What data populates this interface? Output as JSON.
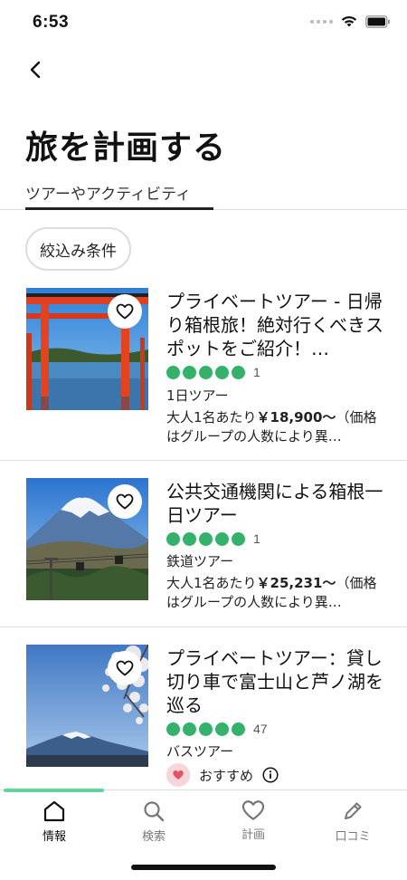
{
  "status_bar": {
    "time": "6:53"
  },
  "header": {
    "title": "旅を計画する",
    "tab": "ツアーやアクティビティ"
  },
  "filter": {
    "label": "絞込み条件"
  },
  "cards": [
    {
      "title": "プライベートツアー - 日帰り箱根旅！絶対行くべきスポットをご紹介！…",
      "rating_count": "1",
      "category": "1日ツアー",
      "price_prefix": "大人1名あたり",
      "price": "￥18,900～",
      "price_suffix": "（価格はグループの人数により異…"
    },
    {
      "title": "公共交通機関による箱根一日ツアー",
      "rating_count": "1",
      "category": "鉄道ツアー",
      "price_prefix": "大人1名あたり",
      "price": "￥25,231～",
      "price_suffix": "（価格はグループの人数により異…"
    },
    {
      "title": "プライベートツアー：貸し切り車で富士山と芦ノ湖を巡る",
      "rating_count": "47",
      "category": "バスツアー",
      "recommend": "おすすめ"
    }
  ],
  "bottom_nav": {
    "items": [
      {
        "label": "情報",
        "icon": "home-icon",
        "active": true
      },
      {
        "label": "検索",
        "icon": "search-icon",
        "active": false
      },
      {
        "label": "計画",
        "icon": "heart-icon",
        "active": false
      },
      {
        "label": "口コミ",
        "icon": "pencil-icon",
        "active": false
      }
    ]
  },
  "colors": {
    "rating": "#34b26b",
    "nav_progress": "#5fd69c",
    "recommend_badge": "#f7d6da"
  }
}
